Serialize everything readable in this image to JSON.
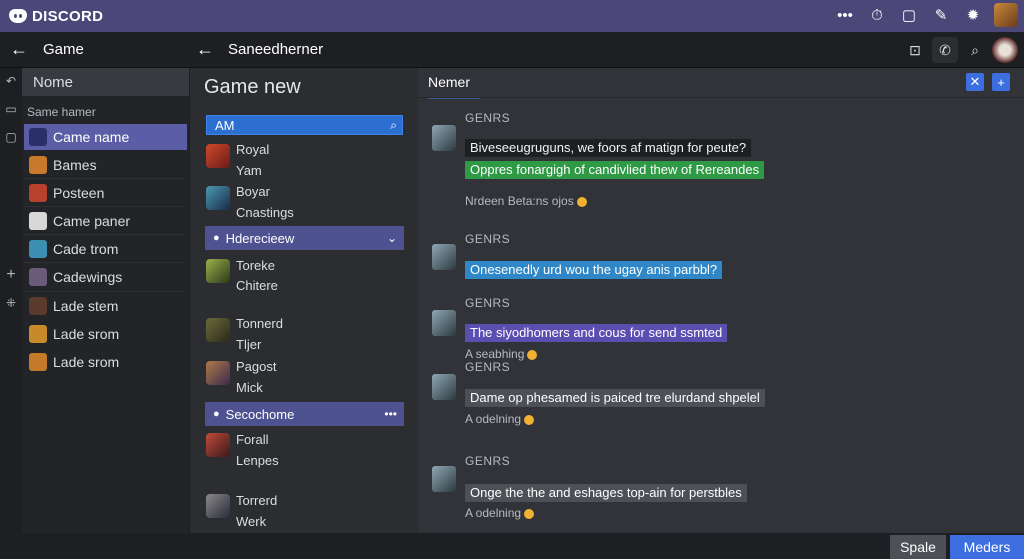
{
  "app": {
    "brand": "DISCORD"
  },
  "subbar": {
    "left_title": "Game",
    "mid_title": "Saneedherner"
  },
  "sidebar": {
    "header": "Nome",
    "subheader": "Same hamer",
    "items": [
      {
        "label": "Came name",
        "selected": true
      },
      {
        "label": "Bames"
      },
      {
        "label": "Posteen"
      },
      {
        "label": "Came paner"
      },
      {
        "label": "Cade trom"
      },
      {
        "label": "Cadewings"
      },
      {
        "label": "Lade stem"
      },
      {
        "label": "Lade srom"
      },
      {
        "label": "Lade srom"
      }
    ]
  },
  "list": {
    "title": "Game new",
    "search_value": "AM",
    "entries": [
      {
        "line1": "Royal",
        "line2": "Yam"
      },
      {
        "line1": "Boyar",
        "line2": "Cnastings"
      },
      {
        "line1": "Toreke",
        "line2": "Chitere"
      },
      {
        "line1": "Tonnerd",
        "line2": "Tljer"
      },
      {
        "line1": "Pagost",
        "line2": "Mick"
      },
      {
        "line1": "Forall",
        "line2": "Lenpes"
      },
      {
        "line1": "Torrerd",
        "line2": "Werk"
      }
    ],
    "bar_a": "Hderecieew",
    "bar_b": "Secochome"
  },
  "chat": {
    "tab": "Nemer",
    "messages": [
      {
        "name": "GENRS",
        "bubbles": [
          {
            "text": "Biveseeugruguns, we foors af matign for peute?",
            "style": "plain"
          },
          {
            "text": "Oppres fonargigh of candivlied thew of Rereandes",
            "style": "green"
          }
        ],
        "reaction": "Nrdeen Beta:ns ojos"
      },
      {
        "name": "GENRS",
        "bubbles": [
          {
            "text": "Onesenedly urd wou the ugay anis parbbl?",
            "style": "blue"
          }
        ]
      },
      {
        "name": "GENRS",
        "bubbles": [
          {
            "text": "The siyodhomers and cous for send ssmted",
            "style": "purple"
          }
        ],
        "reaction": "A seabhing"
      },
      {
        "name": "GENRS",
        "bubbles": [
          {
            "text": "Dame op phesamed is paiced tre elurdand shpelel",
            "style": "gray"
          }
        ],
        "reaction": "A odelning"
      },
      {
        "name": "GENRS",
        "bubbles": [
          {
            "text": "Onge the the and eshages top-ain for perstbles",
            "style": "gray"
          }
        ],
        "reaction": "A odelning"
      }
    ]
  },
  "footer": {
    "spale": "Spale",
    "meders": "Meders"
  }
}
